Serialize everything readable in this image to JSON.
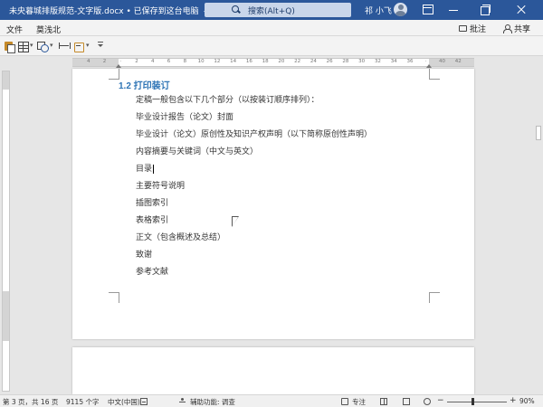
{
  "titlebar": {
    "doc_title": "未央暮城排版规范-文字版.docx • 已保存到这台电脑",
    "search_placeholder": "搜索(Alt+Q)",
    "user_name": "祁 小飞",
    "accent": "#2b579a"
  },
  "menu": {
    "file": "文件",
    "custom": "莫浅北",
    "comment": "批注",
    "share": "共享"
  },
  "ruler": {
    "ticks": [
      "4",
      "2",
      "",
      "2",
      "4",
      "6",
      "8",
      "10",
      "12",
      "14",
      "16",
      "18",
      "20",
      "22",
      "24",
      "26",
      "28",
      "30",
      "32",
      "34",
      "36",
      "",
      "40",
      "42"
    ]
  },
  "document": {
    "heading": "1.2 打印装订",
    "paragraphs": [
      "定稿一般包含以下几个部分（以按装订顺序排列）：",
      "毕业设计报告（论文）封面",
      "毕业设计（论文）原创性及知识产权声明（以下简称原创性声明）",
      "内容摘要与关键词（中文与英文）",
      "目录",
      "主要符号说明",
      "插图索引",
      "表格索引",
      "正文（包含概述及总结）",
      "致谢",
      "参考文献"
    ],
    "heading_color": "#2e74b5"
  },
  "status": {
    "page": "第 3 页，共 16 页",
    "words": "9115 个字",
    "language": "中文(中国)",
    "accessibility": "辅助功能: 调查",
    "focus": "专注",
    "zoom": "90%"
  }
}
